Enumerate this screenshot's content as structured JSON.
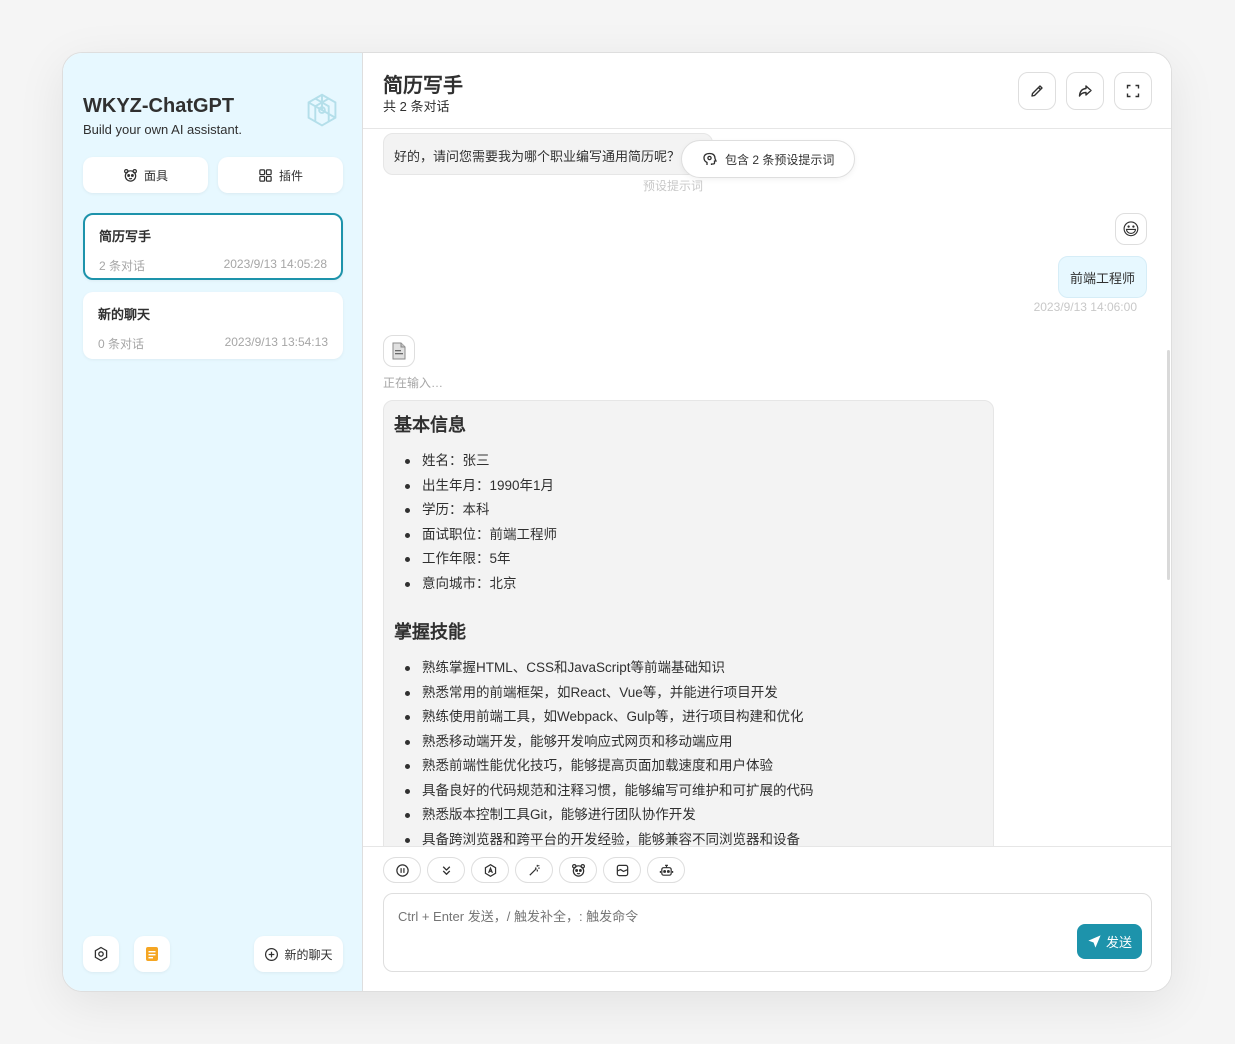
{
  "sidebar": {
    "title": "WKYZ-ChatGPT",
    "subtitle": "Build your own AI assistant.",
    "buttons": {
      "mask": "面具",
      "plugin": "插件"
    },
    "chats": [
      {
        "title": "简历写手",
        "count": "2 条对话",
        "time": "2023/9/13 14:05:28"
      },
      {
        "title": "新的聊天",
        "count": "0 条对话",
        "time": "2023/9/13 13:54:13"
      }
    ],
    "new_chat": "新的聊天"
  },
  "header": {
    "title": "简历写手",
    "subtitle": "共 2 条对话"
  },
  "messages": {
    "preset_bubble": "好的，请问您需要我为哪个职业编写通用简历呢？",
    "preset_pill": "包含 2 条预设提示词",
    "preset_label": "预设提示词",
    "user_avatar": "😃",
    "user_message": "前端工程师",
    "user_time": "2023/9/13 14:06:00",
    "typing": "正在输入…",
    "resume": {
      "section1": {
        "title": "基本信息",
        "items": [
          "姓名：张三",
          "出生年月：1990年1月",
          "学历：本科",
          "面试职位：前端工程师",
          "工作年限：5年",
          "意向城市：北京"
        ]
      },
      "section2": {
        "title": "掌握技能",
        "items": [
          "熟练掌握HTML、CSS和JavaScript等前端基础知识",
          "熟悉常用的前端框架，如React、Vue等，并能进行项目开发",
          "熟练使用前端工具，如Webpack、Gulp等，进行项目构建和优化",
          "熟悉移动端开发，能够开发响应式网页和移动端应用",
          "熟悉前端性能优化技巧，能够提高页面加载速度和用户体验",
          "具备良好的代码规范和注释习惯，能够编写可维护和可扩展的代码",
          "熟悉版本控制工具Git，能够进行团队协作开发",
          "具备跨浏览器和跨平台的开发经验，能够兼容不同浏览器和设备"
        ]
      }
    }
  },
  "input": {
    "placeholder": "Ctrl + Enter 发送，/ 触发补全，: 触发命令",
    "send_label": "发送"
  },
  "colors": {
    "accent": "#1d93ab",
    "sidebar_bg": "#e7f8ff",
    "bubble_user": "#e7f8ff"
  }
}
